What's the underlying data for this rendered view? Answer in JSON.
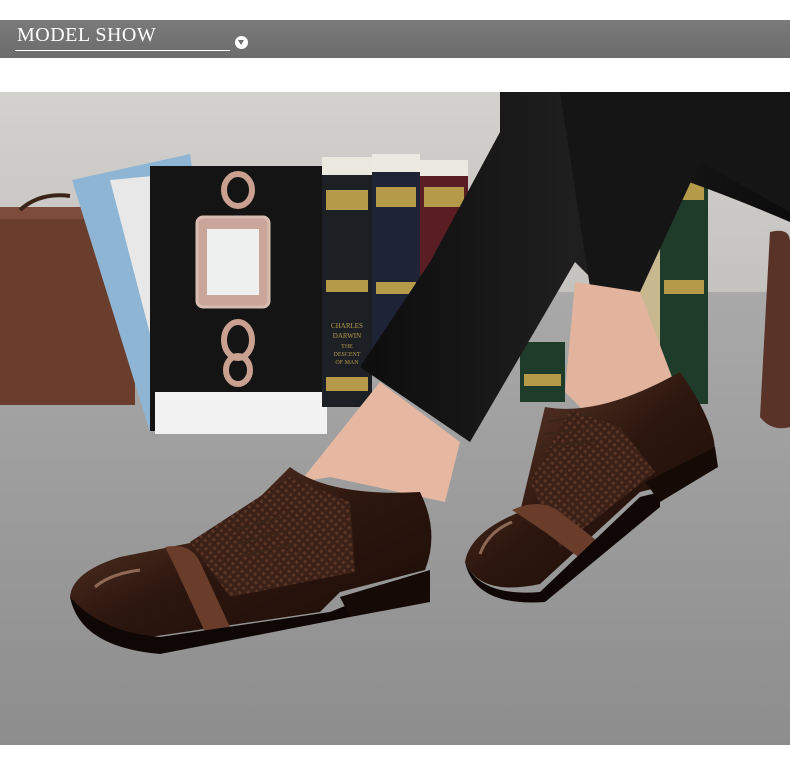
{
  "header": {
    "title": "MODEL SHOW",
    "icon": "chevron-down-circle-icon"
  },
  "photo": {
    "book_spine_texts": [
      "CHARLES DARWIN THE DESCENT OF MAN"
    ]
  },
  "colors": {
    "header_bar": "#707070",
    "shoe_brown": "#4a2a1c",
    "carpet": "#9a9a9a"
  }
}
